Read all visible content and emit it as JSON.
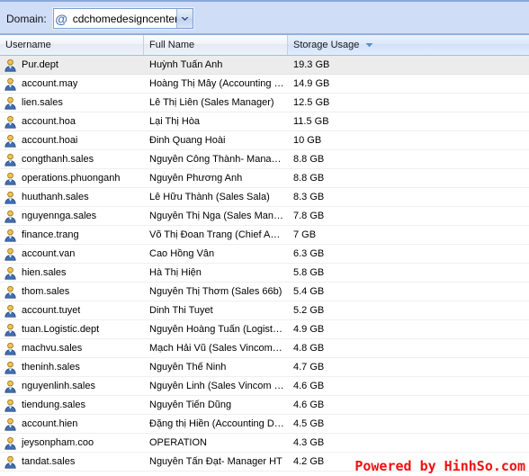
{
  "toolbar": {
    "domain_label": "Domain:",
    "domain_value": "cdchomedesigncenter.cor",
    "at_icon": "at-icon",
    "dropdown_icon": "chevron-down-icon"
  },
  "grid": {
    "columns": [
      {
        "key": "username",
        "label": "Username",
        "sorted": false
      },
      {
        "key": "fullname",
        "label": "Full Name",
        "sorted": false
      },
      {
        "key": "usage",
        "label": "Storage Usage",
        "sorted": true,
        "sort_direction": "desc",
        "sort_icon": "sort-desc-icon"
      }
    ],
    "rows": [
      {
        "username": "Pur.dept",
        "fullname": "Huỳnh Tuấn Anh",
        "usage": "19.3 GB",
        "highlight": true
      },
      {
        "username": "account.may",
        "fullname": "Hoàng Thị Mây (Accounting …",
        "usage": "14.9 GB",
        "highlight": false
      },
      {
        "username": "lien.sales",
        "fullname": "Lê Thị Liên (Sales Manager)",
        "usage": "12.5 GB",
        "highlight": false
      },
      {
        "username": "account.hoa",
        "fullname": "Lại Thị Hòa",
        "usage": "11.5 GB",
        "highlight": false
      },
      {
        "username": "account.hoai",
        "fullname": "Đinh Quang Hoài",
        "usage": "10 GB",
        "highlight": false
      },
      {
        "username": "congthanh.sales",
        "fullname": "Nguyễn Công Thành- Mana…",
        "usage": "8.8 GB",
        "highlight": false
      },
      {
        "username": "operations.phuonganh",
        "fullname": "Nguyễn Phương Anh",
        "usage": "8.8 GB",
        "highlight": false
      },
      {
        "username": "huuthanh.sales",
        "fullname": "Lê Hữu Thành (Sales Sala)",
        "usage": "8.3 GB",
        "highlight": false
      },
      {
        "username": "nguyennga.sales",
        "fullname": "Nguyễn Thị Nga (Sales Man…",
        "usage": "7.8 GB",
        "highlight": false
      },
      {
        "username": "finance.trang",
        "fullname": "Võ Thị Đoan Trang (Chief A…",
        "usage": "7 GB",
        "highlight": false
      },
      {
        "username": "account.van",
        "fullname": "Cao Hồng Vân",
        "usage": "6.3 GB",
        "highlight": false
      },
      {
        "username": "hien.sales",
        "fullname": "Hà Thị Hiện",
        "usage": "5.8 GB",
        "highlight": false
      },
      {
        "username": "thom.sales",
        "fullname": "Nguyễn Thị Thơm (Sales 66b)",
        "usage": "5.4 GB",
        "highlight": false
      },
      {
        "username": "account.tuyet",
        "fullname": "Dinh Thi Tuyet",
        "usage": "5.2 GB",
        "highlight": false
      },
      {
        "username": "tuan.Logistic.dept",
        "fullname": "Nguyễn Hoàng Tuấn (Logist…",
        "usage": "4.9 GB",
        "highlight": false
      },
      {
        "username": "machvu.sales",
        "fullname": "Mạch Hải Vũ (Sales Vincom…",
        "usage": "4.8 GB",
        "highlight": false
      },
      {
        "username": "theninh.sales",
        "fullname": "Nguyễn Thế Ninh",
        "usage": "4.7 GB",
        "highlight": false
      },
      {
        "username": "nguyenlinh.sales",
        "fullname": "Nguyễn Linh (Sales Vincom …",
        "usage": "4.6 GB",
        "highlight": false
      },
      {
        "username": "tiendung.sales",
        "fullname": "Nguyễn Tiến Dũng",
        "usage": "4.6 GB",
        "highlight": false
      },
      {
        "username": "account.hien",
        "fullname": "Đặng thị Hiền (Accounting D…",
        "usage": "4.5 GB",
        "highlight": false
      },
      {
        "username": "jeysonpham.coo",
        "fullname": "OPERATION",
        "usage": "4.3 GB",
        "highlight": false
      },
      {
        "username": "tandat.sales",
        "fullname": "Nguyễn Tấn Đạt- Manager HT",
        "usage": "4.2 GB",
        "highlight": false
      }
    ],
    "row_icon": "user-icon"
  },
  "watermark": {
    "text": "Powered by HinhSo.com",
    "color": "#ee1111"
  }
}
